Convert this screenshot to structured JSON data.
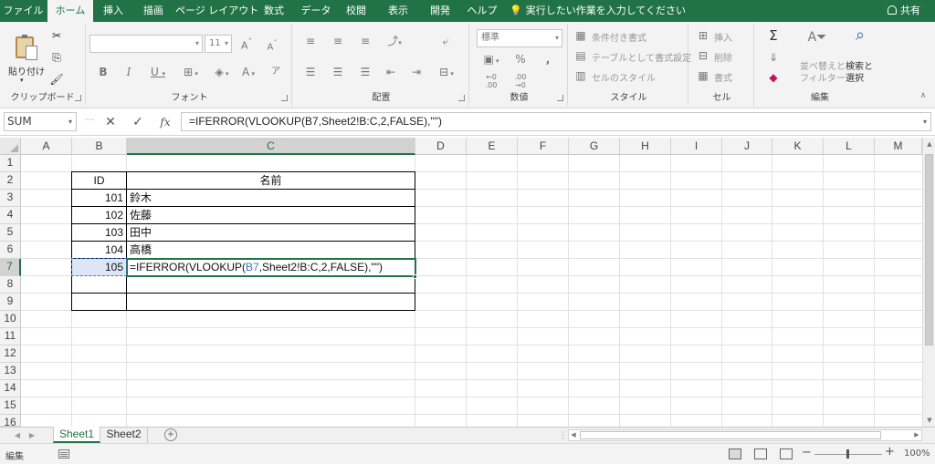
{
  "ribbon_tabs": [
    "ファイル",
    "ホーム",
    "挿入",
    "描画",
    "ページ レイアウト",
    "数式",
    "データ",
    "校閲",
    "表示",
    "開発",
    "ヘルプ"
  ],
  "active_tab": "ホーム",
  "tell_me": "実行したい作業を入力してください",
  "share": "共有",
  "groups": {
    "clipboard": {
      "label": "クリップボード",
      "paste": "貼り付け"
    },
    "font": {
      "label": "フォント",
      "size": "11"
    },
    "alignment": {
      "label": "配置"
    },
    "number": {
      "label": "数値",
      "format": "標準"
    },
    "styles": {
      "label": "スタイル",
      "conditional": "条件付き書式",
      "table": "テーブルとして書式設定",
      "cell_styles": "セルのスタイル"
    },
    "cells": {
      "label": "セル",
      "insert": "挿入",
      "delete": "削除",
      "format": "書式"
    },
    "editing": {
      "label": "編集",
      "sort": "並べ替えと",
      "sort2": "フィルター",
      "find": "検索と",
      "find2": "選択"
    }
  },
  "formula_bar": {
    "name_box": "SUM",
    "formula": "=IFERROR(VLOOKUP(B7,Sheet2!B:C,2,FALSE),\"\")"
  },
  "grid": {
    "columns": [
      "A",
      "B",
      "C",
      "D",
      "E",
      "F",
      "G",
      "H",
      "I",
      "J",
      "K",
      "L",
      "M"
    ],
    "rows": [
      "1",
      "2",
      "3",
      "4",
      "5",
      "6",
      "7",
      "8",
      "9",
      "10",
      "11",
      "12",
      "13",
      "14",
      "15",
      "16"
    ],
    "selected_column": "C",
    "selected_row": "7",
    "table": {
      "header_id": "ID",
      "header_name": "名前",
      "rows": [
        {
          "id": "101",
          "name": "鈴木"
        },
        {
          "id": "102",
          "name": "佐藤"
        },
        {
          "id": "103",
          "name": "田中"
        },
        {
          "id": "104",
          "name": "高橋"
        },
        {
          "id": "105"
        }
      ],
      "edit_prefix": "=IFERROR(VLOOKUP(",
      "edit_ref": "B7",
      "edit_suffix": ",Sheet2!B:C,2,FALSE),\"\")"
    }
  },
  "sheets": [
    "Sheet1",
    "Sheet2"
  ],
  "active_sheet": "Sheet1",
  "status": {
    "mode": "編集",
    "zoom": "100%"
  }
}
